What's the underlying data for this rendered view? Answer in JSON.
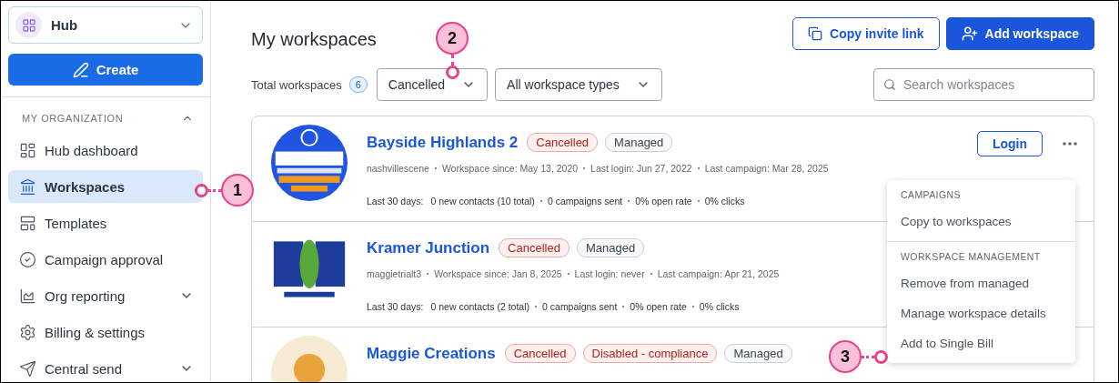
{
  "sidebar": {
    "switcher": {
      "label": "Hub"
    },
    "create_button": "Create",
    "section": {
      "title": "MY ORGANIZATION",
      "expanded": true
    },
    "items": [
      {
        "label": "Hub dashboard",
        "selected": false,
        "has_submenu": false
      },
      {
        "label": "Workspaces",
        "selected": true,
        "has_submenu": false
      },
      {
        "label": "Templates",
        "selected": false,
        "has_submenu": false
      },
      {
        "label": "Campaign approval",
        "selected": false,
        "has_submenu": false
      },
      {
        "label": "Org reporting",
        "selected": false,
        "has_submenu": true
      },
      {
        "label": "Billing & settings",
        "selected": false,
        "has_submenu": false
      },
      {
        "label": "Central send",
        "selected": false,
        "has_submenu": true
      }
    ]
  },
  "page": {
    "title": "My workspaces",
    "actions": [
      {
        "label": "Copy invite link",
        "kind": "secondary"
      },
      {
        "label": "Add workspace",
        "kind": "primary"
      }
    ],
    "total_label": "Total workspaces",
    "total_count": "6",
    "filters": [
      "Cancelled",
      "All workspace types"
    ],
    "search": {
      "placeholder": "Search workspaces"
    }
  },
  "workspaces": [
    {
      "name": "Bayside Highlands 2",
      "badges": [
        {
          "label": "Cancelled",
          "kind": "danger"
        },
        {
          "label": "Managed",
          "kind": "neutral"
        }
      ],
      "meta": [
        "nashvillescene",
        "Workspace since: May 13, 2020",
        "Last login: Jun 27, 2022",
        "Last campaign: Mar 28, 2025"
      ],
      "stats_label": "Last 30 days:",
      "stats": [
        "0 new contacts (10 total)",
        "0 campaigns sent",
        "0% open rate",
        "0% clicks"
      ],
      "login": "Login"
    },
    {
      "name": "Kramer Junction",
      "badges": [
        {
          "label": "Cancelled",
          "kind": "danger"
        },
        {
          "label": "Managed",
          "kind": "neutral"
        }
      ],
      "meta": [
        "maggietrialt3",
        "Workspace since: Jan 8, 2025",
        "Last login: never",
        "Last campaign: Apr 21, 2025"
      ],
      "stats_label": "Last 30 days:",
      "stats": [
        "0 new contacts (2 total)",
        "0 campaigns sent",
        "0% open rate",
        "0% clicks"
      ]
    },
    {
      "name": "Maggie Creations",
      "badges": [
        {
          "label": "Cancelled",
          "kind": "danger"
        },
        {
          "label": "Disabled - compliance",
          "kind": "danger"
        },
        {
          "label": "Managed",
          "kind": "neutral"
        }
      ]
    }
  ],
  "menu": {
    "sections": [
      {
        "title": "CAMPAIGNS",
        "items": [
          "Copy to workspaces"
        ]
      },
      {
        "title": "WORKSPACE MANAGEMENT",
        "items": [
          "Remove from managed",
          "Manage workspace details",
          "Add to Single Bill"
        ]
      }
    ]
  },
  "callouts": [
    "1",
    "2",
    "3"
  ]
}
